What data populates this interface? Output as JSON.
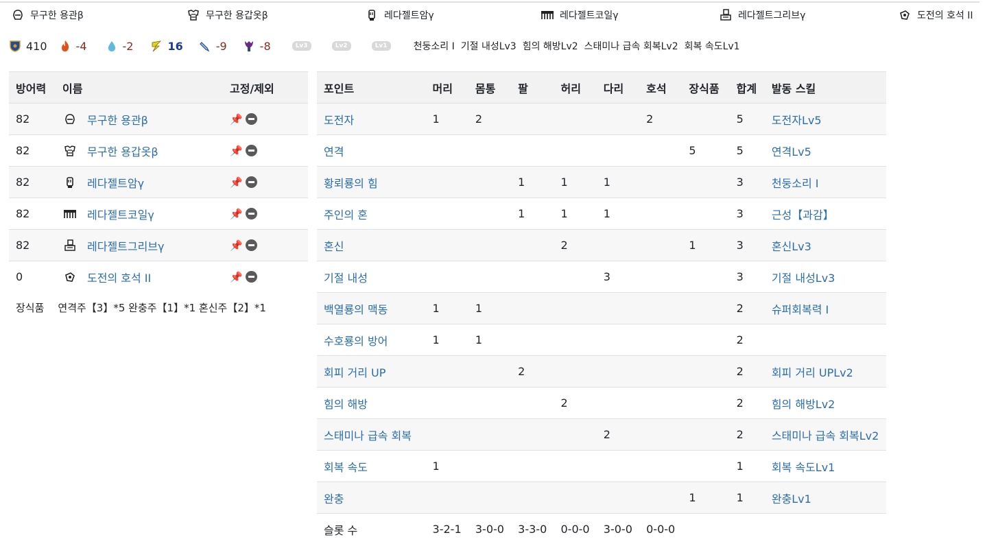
{
  "equipment": [
    {
      "icon": "helm-icon",
      "name": "무구한 용관β"
    },
    {
      "icon": "chest-icon",
      "name": "무구한 용갑옷β"
    },
    {
      "icon": "arm-icon",
      "name": "레다젤트암γ"
    },
    {
      "icon": "waist-icon",
      "name": "레다젤트코일γ"
    },
    {
      "icon": "leg-icon",
      "name": "레다젤트그리브γ"
    },
    {
      "icon": "charm-icon",
      "name": "도전의 호석 II"
    }
  ],
  "stats": {
    "defense": "410",
    "fire": "-4",
    "water": "-2",
    "thunder": "16",
    "ice": "-9",
    "dragon": "-8",
    "colors": {
      "fire": "#8b2b1e",
      "water": "#8b2b1e",
      "thunder": "#1e3a9c",
      "ice": "#8b2b1e",
      "dragon": "#8b2b1e"
    }
  },
  "deco_slots": [
    "Lv3",
    "Lv2",
    "Lv1"
  ],
  "skill_summary": [
    "천둥소리 I",
    "기절 내성Lv3",
    "힘의 해방Lv2",
    "스태미나 급속 회복Lv2",
    "회복 속도Lv1"
  ],
  "armor_table": {
    "headers": {
      "defense": "방어력",
      "name": "이름",
      "fix": "고정/제외"
    },
    "rows": [
      {
        "defense": "82",
        "icon": "helm-icon",
        "name": "무구한 용관β"
      },
      {
        "defense": "82",
        "icon": "chest-icon",
        "name": "무구한 용갑옷β"
      },
      {
        "defense": "82",
        "icon": "arm-icon",
        "name": "레다젤트암γ"
      },
      {
        "defense": "82",
        "icon": "waist-icon",
        "name": "레다젤트코일γ"
      },
      {
        "defense": "82",
        "icon": "leg-icon",
        "name": "레다젤트그리브γ"
      },
      {
        "defense": "0",
        "icon": "charm-icon",
        "name": "도전의 호석 II"
      }
    ],
    "decorations_label": "장식품",
    "decorations": "연격주【3】*5 완충주【1】*1 혼신주【2】*1"
  },
  "points_table": {
    "headers": [
      "포인트",
      "머리",
      "몸통",
      "팔",
      "허리",
      "다리",
      "호석",
      "장식품",
      "합계",
      "발동 스킬"
    ],
    "rows": [
      {
        "point": "도전자",
        "head": "1",
        "body": "2",
        "arm": "",
        "waist": "",
        "leg": "",
        "charm": "2",
        "deco": "",
        "total": "5",
        "skill": "도전자Lv5"
      },
      {
        "point": "연격",
        "head": "",
        "body": "",
        "arm": "",
        "waist": "",
        "leg": "",
        "charm": "",
        "deco": "5",
        "total": "5",
        "skill": "연격Lv5"
      },
      {
        "point": "황뢰룡의 힘",
        "head": "",
        "body": "",
        "arm": "1",
        "waist": "1",
        "leg": "1",
        "charm": "",
        "deco": "",
        "total": "3",
        "skill": "천둥소리 I"
      },
      {
        "point": "주인의 혼",
        "head": "",
        "body": "",
        "arm": "1",
        "waist": "1",
        "leg": "1",
        "charm": "",
        "deco": "",
        "total": "3",
        "skill": "근성【과감】"
      },
      {
        "point": "혼신",
        "head": "",
        "body": "",
        "arm": "",
        "waist": "2",
        "leg": "",
        "charm": "",
        "deco": "1",
        "total": "3",
        "skill": "혼신Lv3"
      },
      {
        "point": "기절 내성",
        "head": "",
        "body": "",
        "arm": "",
        "waist": "",
        "leg": "3",
        "charm": "",
        "deco": "",
        "total": "3",
        "skill": "기절 내성Lv3"
      },
      {
        "point": "백열룡의 맥동",
        "head": "1",
        "body": "1",
        "arm": "",
        "waist": "",
        "leg": "",
        "charm": "",
        "deco": "",
        "total": "2",
        "skill": "슈퍼회복력 I"
      },
      {
        "point": "수호룡의 방어",
        "head": "1",
        "body": "1",
        "arm": "",
        "waist": "",
        "leg": "",
        "charm": "",
        "deco": "",
        "total": "2",
        "skill": ""
      },
      {
        "point": "회피 거리 UP",
        "head": "",
        "body": "",
        "arm": "2",
        "waist": "",
        "leg": "",
        "charm": "",
        "deco": "",
        "total": "2",
        "skill": "회피 거리 UPLv2"
      },
      {
        "point": "힘의 해방",
        "head": "",
        "body": "",
        "arm": "",
        "waist": "2",
        "leg": "",
        "charm": "",
        "deco": "",
        "total": "2",
        "skill": "힘의 해방Lv2"
      },
      {
        "point": "스태미나 급속 회복",
        "head": "",
        "body": "",
        "arm": "",
        "waist": "",
        "leg": "2",
        "charm": "",
        "deco": "",
        "total": "2",
        "skill": "스태미나 급속 회복Lv2"
      },
      {
        "point": "회복 속도",
        "head": "1",
        "body": "",
        "arm": "",
        "waist": "",
        "leg": "",
        "charm": "",
        "deco": "",
        "total": "1",
        "skill": "회복 속도Lv1"
      },
      {
        "point": "완충",
        "head": "",
        "body": "",
        "arm": "",
        "waist": "",
        "leg": "",
        "charm": "",
        "deco": "1",
        "total": "1",
        "skill": "완충Lv1"
      }
    ],
    "slots_row": {
      "label": "슬롯 수",
      "head": "3-2-1",
      "body": "3-0-0",
      "arm": "3-3-0",
      "waist": "0-0-0",
      "leg": "3-0-0",
      "charm": "0-0-0"
    }
  }
}
